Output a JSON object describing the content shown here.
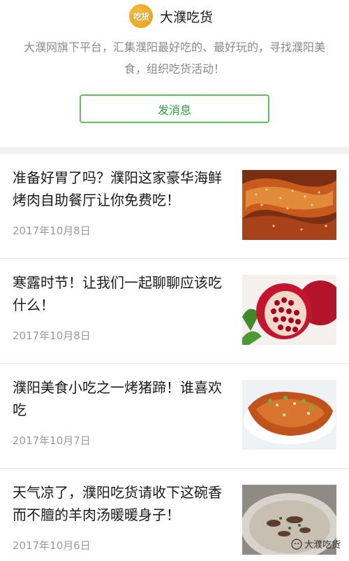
{
  "account": {
    "name": "大濮吃货",
    "logo_text": "吃货",
    "description": "大濮网旗下平台，汇集濮阳最好吃的、最好玩的，寻找濮阳美食，组织吃货活动！",
    "send_message_label": "发消息"
  },
  "articles": [
    {
      "title": "准备好胃了吗？濮阳这家豪华海鲜烤肉自助餐厅让你免费吃！",
      "date": "2017年10月8日",
      "thumbnail": "grilled-meat-image"
    },
    {
      "title": "寒露时节！让我们一起聊聊应该吃什么！",
      "date": "2017年10月8日",
      "thumbnail": "pomegranate-image"
    },
    {
      "title": "濮阳美食小吃之一烤猪蹄！谁喜欢吃",
      "date": "2017年10月7日",
      "thumbnail": "roast-pig-trotter-image"
    },
    {
      "title": "天气凉了，濮阳吃货请收下这碗香而不膻的羊肉汤暖暖身子！",
      "date": "2017年10月6日",
      "thumbnail": "mutton-soup-image"
    }
  ],
  "watermark": {
    "text": "大濮吃货",
    "icon": "wechat-official-icon"
  },
  "colors": {
    "accent_green": "#2ea043",
    "button_border": "#5fbf5f",
    "date_gray": "#9a9a9a"
  }
}
